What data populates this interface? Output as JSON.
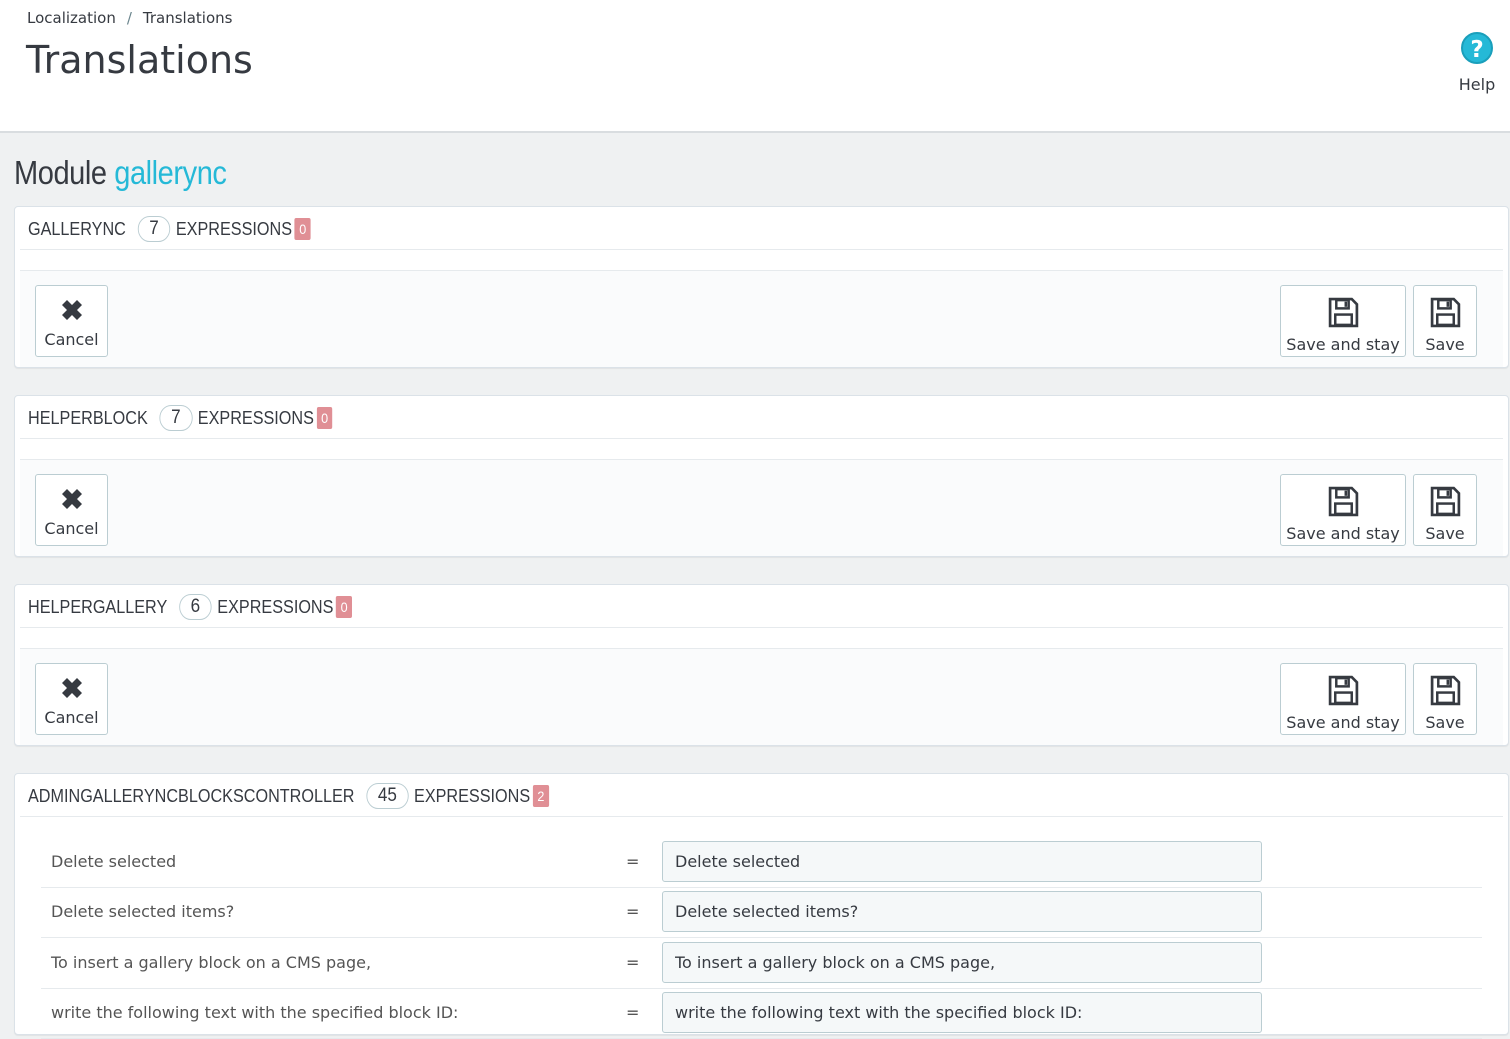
{
  "breadcrumb": {
    "parent": "Localization",
    "separator": "/",
    "current": "Translations"
  },
  "page_title": "Translations",
  "help": {
    "label": "Help",
    "icon": "help-icon"
  },
  "module": {
    "prefix": "Module",
    "name": "gallerync"
  },
  "buttons": {
    "cancel": "Cancel",
    "save_and_stay": "Save and stay",
    "save": "Save"
  },
  "expressions_label": "EXPRESSIONS",
  "panels": [
    {
      "name": "GALLERYNC",
      "count": "7",
      "missing": "0"
    },
    {
      "name": "HELPERBLOCK",
      "count": "7",
      "missing": "0"
    },
    {
      "name": "HELPERGALLERY",
      "count": "6",
      "missing": "0"
    },
    {
      "name": "ADMINGALLERYNCBLOCKSCONTROLLER",
      "count": "45",
      "missing": "2"
    }
  ],
  "translations": [
    {
      "source": "Delete selected",
      "eq": "=",
      "value": "Delete selected"
    },
    {
      "source": "Delete selected items?",
      "eq": "=",
      "value": "Delete selected items?"
    },
    {
      "source": "To insert a gallery block on a CMS page,",
      "eq": "=",
      "value": "To insert a gallery block on a CMS page,"
    },
    {
      "source": "write the following text with the specified block ID:",
      "eq": "=",
      "value": "write the following text with the specified block ID:"
    }
  ],
  "colors": {
    "accent": "#25b9d7",
    "missing_badge": "#e08f95",
    "page_bg": "#eff1f2"
  }
}
